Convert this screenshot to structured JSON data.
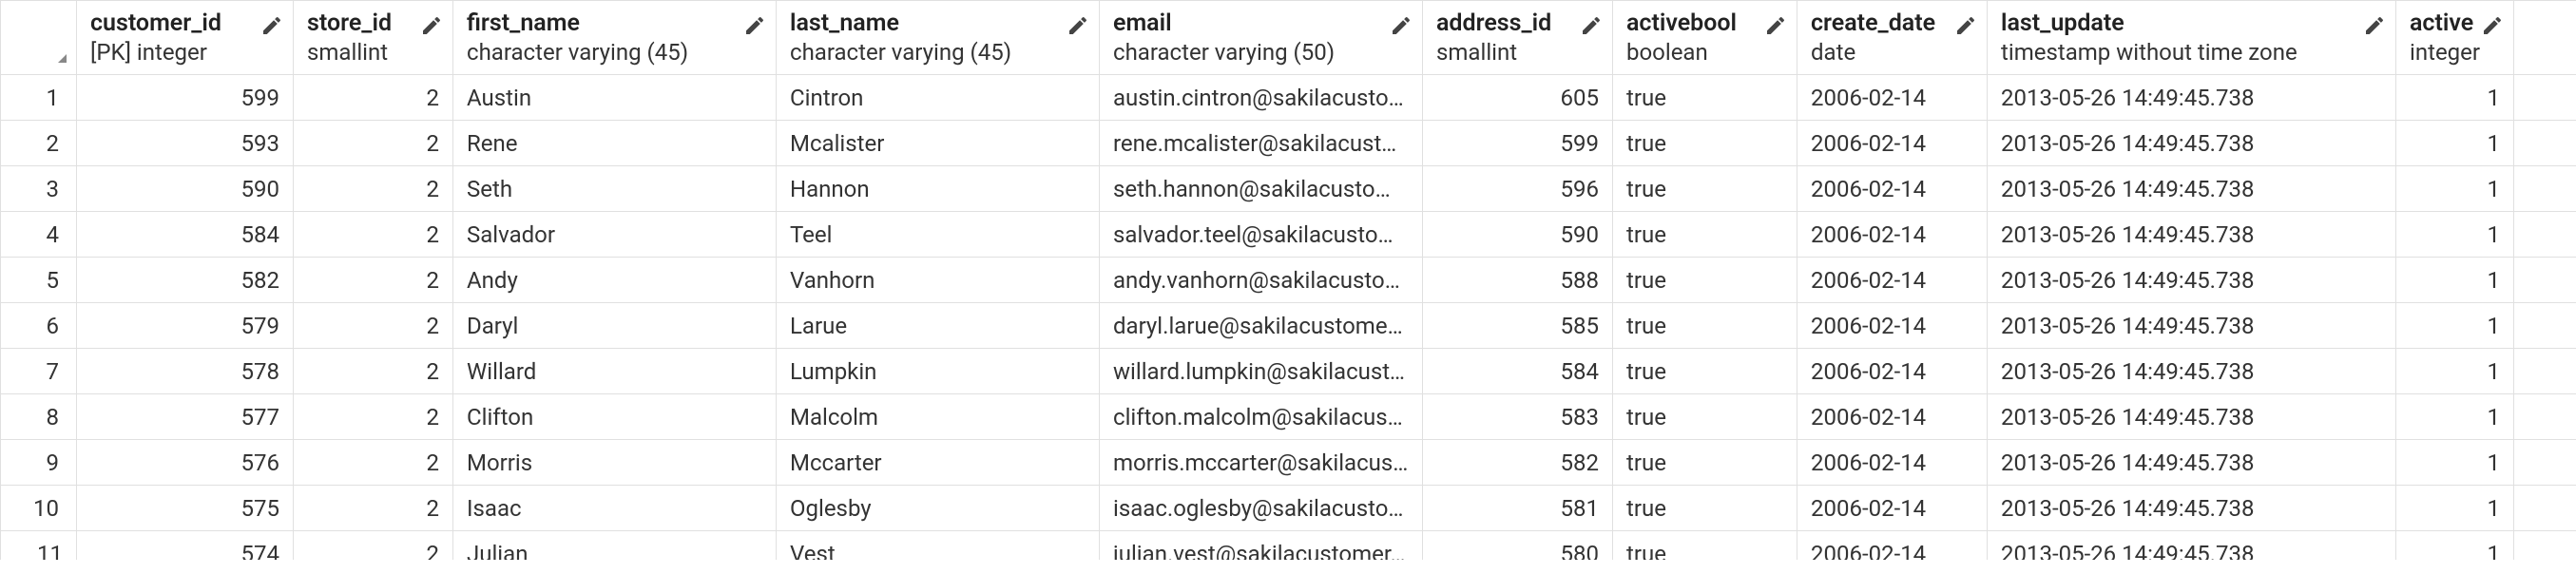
{
  "columns": [
    {
      "name": "customer_id",
      "type": "[PK] integer",
      "editable": true,
      "align": "right"
    },
    {
      "name": "store_id",
      "type": "smallint",
      "editable": true,
      "align": "right"
    },
    {
      "name": "first_name",
      "type": "character varying (45)",
      "editable": true,
      "align": "left"
    },
    {
      "name": "last_name",
      "type": "character varying (45)",
      "editable": true,
      "align": "left"
    },
    {
      "name": "email",
      "type": "character varying (50)",
      "editable": true,
      "align": "left"
    },
    {
      "name": "address_id",
      "type": "smallint",
      "editable": true,
      "align": "right"
    },
    {
      "name": "activebool",
      "type": "boolean",
      "editable": true,
      "align": "left"
    },
    {
      "name": "create_date",
      "type": "date",
      "editable": true,
      "align": "left"
    },
    {
      "name": "last_update",
      "type": "timestamp without time zone",
      "editable": true,
      "align": "left"
    },
    {
      "name": "active",
      "type": "integer",
      "editable": true,
      "align": "right"
    }
  ],
  "rows": [
    {
      "n": "1",
      "customer_id": "599",
      "store_id": "2",
      "first_name": "Austin",
      "last_name": "Cintron",
      "email": "austin.cintron@sakilacusto…",
      "address_id": "605",
      "activebool": "true",
      "create_date": "2006-02-14",
      "last_update": "2013-05-26 14:49:45.738",
      "active": "1"
    },
    {
      "n": "2",
      "customer_id": "593",
      "store_id": "2",
      "first_name": "Rene",
      "last_name": "Mcalister",
      "email": "rene.mcalister@sakilacusto…",
      "address_id": "599",
      "activebool": "true",
      "create_date": "2006-02-14",
      "last_update": "2013-05-26 14:49:45.738",
      "active": "1"
    },
    {
      "n": "3",
      "customer_id": "590",
      "store_id": "2",
      "first_name": "Seth",
      "last_name": "Hannon",
      "email": "seth.hannon@sakilacustom…",
      "address_id": "596",
      "activebool": "true",
      "create_date": "2006-02-14",
      "last_update": "2013-05-26 14:49:45.738",
      "active": "1"
    },
    {
      "n": "4",
      "customer_id": "584",
      "store_id": "2",
      "first_name": "Salvador",
      "last_name": "Teel",
      "email": "salvador.teel@sakilacustom…",
      "address_id": "590",
      "activebool": "true",
      "create_date": "2006-02-14",
      "last_update": "2013-05-26 14:49:45.738",
      "active": "1"
    },
    {
      "n": "5",
      "customer_id": "582",
      "store_id": "2",
      "first_name": "Andy",
      "last_name": "Vanhorn",
      "email": "andy.vanhorn@sakilacusto…",
      "address_id": "588",
      "activebool": "true",
      "create_date": "2006-02-14",
      "last_update": "2013-05-26 14:49:45.738",
      "active": "1"
    },
    {
      "n": "6",
      "customer_id": "579",
      "store_id": "2",
      "first_name": "Daryl",
      "last_name": "Larue",
      "email": "daryl.larue@sakilacustomer.…",
      "address_id": "585",
      "activebool": "true",
      "create_date": "2006-02-14",
      "last_update": "2013-05-26 14:49:45.738",
      "active": "1"
    },
    {
      "n": "7",
      "customer_id": "578",
      "store_id": "2",
      "first_name": "Willard",
      "last_name": "Lumpkin",
      "email": "willard.lumpkin@sakilacusto…",
      "address_id": "584",
      "activebool": "true",
      "create_date": "2006-02-14",
      "last_update": "2013-05-26 14:49:45.738",
      "active": "1"
    },
    {
      "n": "8",
      "customer_id": "577",
      "store_id": "2",
      "first_name": "Clifton",
      "last_name": "Malcolm",
      "email": "clifton.malcolm@sakilacust…",
      "address_id": "583",
      "activebool": "true",
      "create_date": "2006-02-14",
      "last_update": "2013-05-26 14:49:45.738",
      "active": "1"
    },
    {
      "n": "9",
      "customer_id": "576",
      "store_id": "2",
      "first_name": "Morris",
      "last_name": "Mccarter",
      "email": "morris.mccarter@sakilacust…",
      "address_id": "582",
      "activebool": "true",
      "create_date": "2006-02-14",
      "last_update": "2013-05-26 14:49:45.738",
      "active": "1"
    },
    {
      "n": "10",
      "customer_id": "575",
      "store_id": "2",
      "first_name": "Isaac",
      "last_name": "Oglesby",
      "email": "isaac.oglesby@sakilacusto…",
      "address_id": "581",
      "activebool": "true",
      "create_date": "2006-02-14",
      "last_update": "2013-05-26 14:49:45.738",
      "active": "1"
    },
    {
      "n": "11",
      "customer_id": "574",
      "store_id": "2",
      "first_name": "Julian",
      "last_name": "Vest",
      "email": "julian.vest@sakilacustomer…",
      "address_id": "580",
      "activebool": "true",
      "create_date": "2006-02-14",
      "last_update": "2013-05-26 14:49:45.738",
      "active": "1"
    }
  ]
}
